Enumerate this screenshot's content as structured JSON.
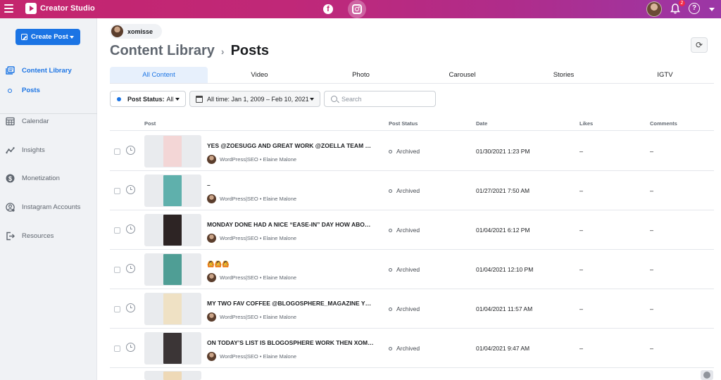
{
  "app": {
    "title": "Creator Studio",
    "notification_count": "2",
    "facebook_glyph": "f",
    "help_glyph": "?"
  },
  "sidebar": {
    "create_post_label": "Create Post",
    "items": [
      {
        "label": "Content Library",
        "icon": "content-library-icon",
        "active": true
      },
      {
        "label": "Posts",
        "icon": "dot-icon",
        "sub": true
      },
      {
        "label": "Calendar",
        "icon": "calendar-icon"
      },
      {
        "label": "Insights",
        "icon": "insights-icon"
      },
      {
        "label": "Monetization",
        "icon": "dollar-icon"
      },
      {
        "label": "Instagram Accounts",
        "icon": "account-gear-icon"
      },
      {
        "label": "Resources",
        "icon": "exit-door-icon"
      }
    ]
  },
  "main": {
    "account_name": "xomisse",
    "breadcrumb": {
      "root": "Content Library",
      "separator": "›",
      "current": "Posts"
    },
    "refresh_glyph": "⟳",
    "tabs": [
      "All Content",
      "Video",
      "Photo",
      "Carousel",
      "Stories",
      "IGTV"
    ],
    "filters": {
      "status_prefix": "Post Status:",
      "status_value": "All",
      "date_range": "All time: Jan 1, 2009 – Feb 10, 2021",
      "search_placeholder": "Search"
    },
    "columns": [
      "Post",
      "Post Status",
      "Date",
      "Likes",
      "Comments"
    ],
    "rows": [
      {
        "title": "YES @ZOESUGG AND GREAT WORK @ZOELLA TEAM LOVE",
        "meta": "WordPress|SEO • Elaine Malone",
        "status": "Archived",
        "date": "01/30/2021 1:23 PM",
        "likes": "–",
        "comments": "–",
        "thumb_color": "#f3d6d6"
      },
      {
        "title": "–",
        "meta": "WordPress|SEO • Elaine Malone",
        "status": "Archived",
        "date": "01/27/2021 7:50 AM",
        "likes": "–",
        "comments": "–",
        "thumb_color": "#5fb0ac"
      },
      {
        "title": "MONDAY DONE HAD A NICE “EASE-IN” DAY HOW ABOUT YOU",
        "meta": "WordPress|SEO • Elaine Malone",
        "status": "Archived",
        "date": "01/04/2021 6:12 PM",
        "likes": "–",
        "comments": "–",
        "thumb_color": "#2d2424"
      },
      {
        "title": "🙆🙆🙆",
        "meta": "WordPress|SEO • Elaine Malone",
        "status": "Archived",
        "date": "01/04/2021 12:10 PM",
        "likes": "–",
        "comments": "–",
        "thumb_color": "#4f9e95"
      },
      {
        "title": "MY TWO FAV COFFEE @BLOGOSPHERE_MAGAZINE YOU HAVE",
        "meta": "WordPress|SEO • Elaine Malone",
        "status": "Archived",
        "date": "01/04/2021 11:57 AM",
        "likes": "–",
        "comments": "–",
        "thumb_color": "#efe1c4"
      },
      {
        "title": "ON TODAY’S LIST IS BLOGOSPHERE WORK THEN XOMISSE",
        "meta": "WordPress|SEO • Elaine Malone",
        "status": "Archived",
        "date": "01/04/2021 9:47 AM",
        "likes": "–",
        "comments": "–",
        "thumb_color": "#3b3536"
      }
    ]
  },
  "colors": {
    "accent": "#1b74e4",
    "topbar_start": "#c4256e",
    "topbar_end": "#9b37a6"
  }
}
